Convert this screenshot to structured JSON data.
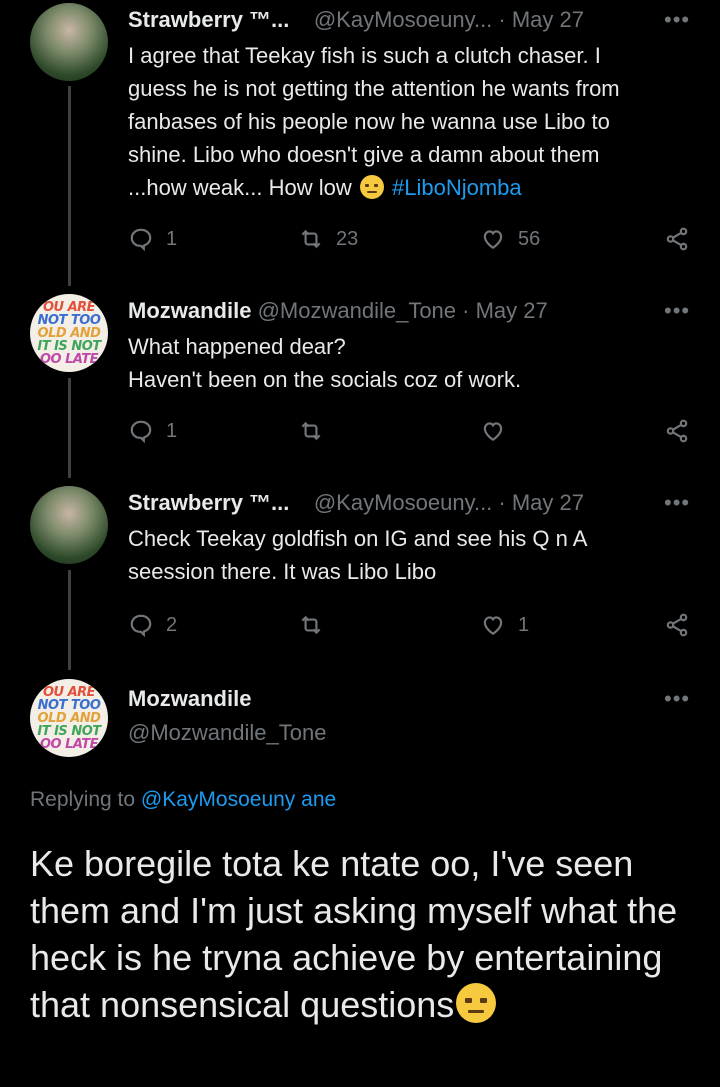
{
  "tweets": [
    {
      "name": "Strawberry ™...",
      "handle_date": "@KayMosoeuny... · May 27",
      "lines": [
        "I agree that Teekay fish is such a clutch chaser. I",
        "guess he is not getting the attention he wants from",
        "fanbases of his people now he wanna use Libo to",
        "shine. Libo who doesn't give a damn about them",
        "...how weak... How low"
      ],
      "hashtag": "#LiboNjomba",
      "replies": "1",
      "retweets": "23",
      "likes": "56"
    },
    {
      "name": "Mozwandile",
      "handle_date": "@Mozwandile_Tone · May 27",
      "lines": [
        "What happened dear?",
        "Haven't been on the socials coz of work."
      ],
      "replies": "1",
      "retweets": "",
      "likes": ""
    },
    {
      "name": "Strawberry ™...",
      "handle_date": "@KayMosoeuny... · May 27",
      "lines": [
        "Check Teekay goldfish on IG and see his Q n A",
        "seession there. It was Libo Libo"
      ],
      "replies": "2",
      "retweets": "",
      "likes": "1"
    }
  ],
  "avatar_text": [
    "OU ARE",
    "NOT TOO",
    "OLD AND",
    "IT IS NOT",
    "OO LATE"
  ],
  "main_tweet": {
    "name": "Mozwandile",
    "handle": "@Mozwandile_Tone",
    "replying_prefix": "Replying to",
    "replying_handle": "@KayMosoeuny ane",
    "text": "Ke boregile tota ke ntate oo, I've seen them and I'm just asking myself what the heck is he tryna achieve by entertaining that nonsensical questions"
  },
  "more_label": "•••",
  "colors": {
    "background": "#000000",
    "text": "#e7e9ea",
    "muted": "#71767b",
    "accent": "#1d9bf0"
  }
}
